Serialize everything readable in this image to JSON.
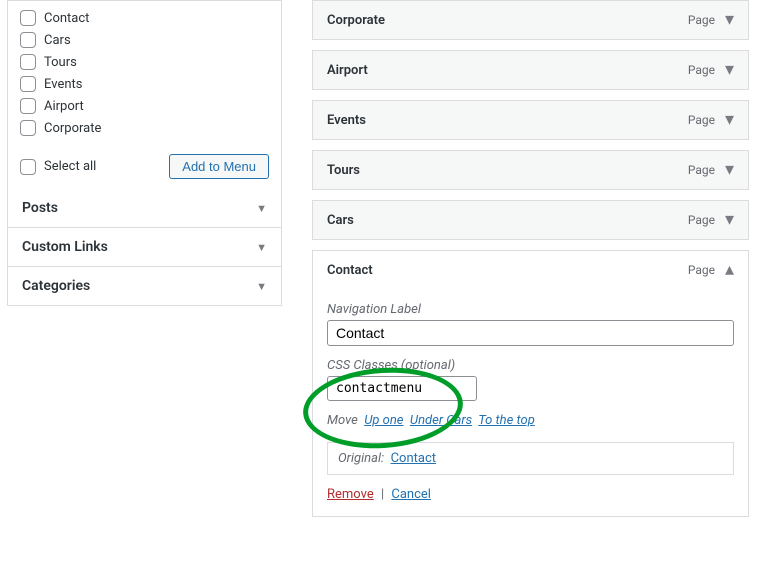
{
  "left": {
    "pages": [
      "Contact",
      "Cars",
      "Tours",
      "Events",
      "Airport",
      "Corporate"
    ],
    "select_all_label": "Select all",
    "add_button": "Add to Menu",
    "accordions": [
      "Posts",
      "Custom Links",
      "Categories"
    ]
  },
  "menu": {
    "items": [
      {
        "label": "Corporate",
        "type": "Page"
      },
      {
        "label": "Airport",
        "type": "Page"
      },
      {
        "label": "Events",
        "type": "Page"
      },
      {
        "label": "Tours",
        "type": "Page"
      },
      {
        "label": "Cars",
        "type": "Page"
      },
      {
        "label": "Contact",
        "type": "Page"
      }
    ]
  },
  "expanded": {
    "nav_label_caption": "Navigation Label",
    "nav_label_value": "Contact",
    "css_caption": "CSS Classes (optional)",
    "css_value": "contactmenu",
    "move_label": "Move",
    "move_up": "Up one",
    "move_under": "Under Cars",
    "move_top": "To the top",
    "original_label": "Original:",
    "original_link": "Contact",
    "remove": "Remove",
    "cancel": "Cancel"
  }
}
